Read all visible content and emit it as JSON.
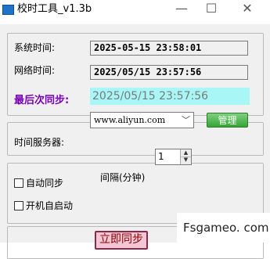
{
  "window": {
    "title": "校时工具_v1.3b",
    "min_glyph": "—",
    "max_glyph": "☐",
    "close_glyph": "✕"
  },
  "times": {
    "system_label": "系统时间:",
    "system_value": "2025-05-15  23:58:01",
    "network_label": "网络时间:",
    "network_value": "2025/05/15  23:57:56",
    "last_sync_label": "最后次同步:",
    "last_sync_value": "2025/05/15 23:57:56"
  },
  "server": {
    "label": "时间服务器:",
    "selected": "www.aliyun.com",
    "manage_label": "管理"
  },
  "options": {
    "auto_sync_label": "自动同步",
    "auto_sync_checked": false,
    "autostart_label": "开机自启动",
    "autostart_checked": false,
    "interval_label": "间隔(分钟)",
    "interval_value": "1"
  },
  "actions": {
    "sync_now_label": "立即同步"
  },
  "watermark": "Fsgameo. com",
  "colors": {
    "accent_purple": "#7a00b8",
    "highlight_cyan": "#a8f6f6",
    "manage_green": "#35a535"
  }
}
